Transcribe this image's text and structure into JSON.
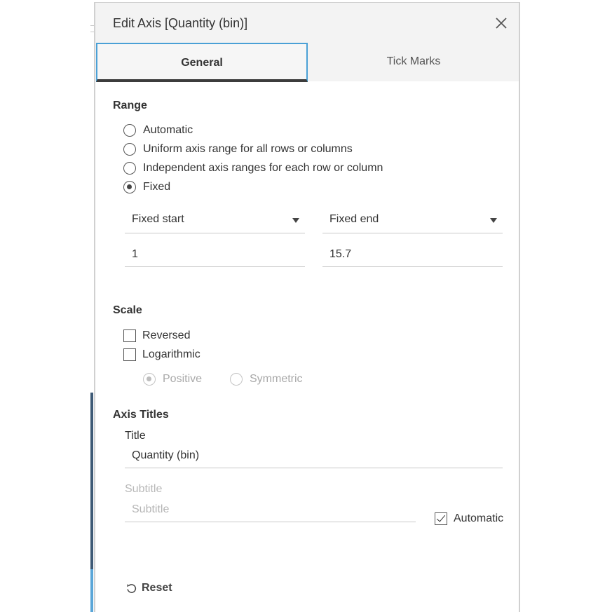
{
  "dialog": {
    "title": "Edit Axis [Quantity (bin)]"
  },
  "tabs": [
    {
      "label": "General",
      "active": true
    },
    {
      "label": "Tick Marks",
      "active": false
    }
  ],
  "range": {
    "heading": "Range",
    "options": [
      {
        "label": "Automatic",
        "checked": false
      },
      {
        "label": "Uniform axis range for all rows or columns",
        "checked": false
      },
      {
        "label": "Independent axis ranges for each row or column",
        "checked": false
      },
      {
        "label": "Fixed",
        "checked": true
      }
    ],
    "start_select": "Fixed start",
    "end_select": "Fixed end",
    "start_value": "1",
    "end_value": "15.7"
  },
  "scale": {
    "heading": "Scale",
    "reversed": {
      "label": "Reversed",
      "checked": false
    },
    "logarithmic": {
      "label": "Logarithmic",
      "checked": false
    },
    "log_options": [
      {
        "label": "Positive",
        "checked": true,
        "disabled": true
      },
      {
        "label": "Symmetric",
        "checked": false,
        "disabled": true
      }
    ]
  },
  "axis_titles": {
    "heading": "Axis Titles",
    "title_label": "Title",
    "title_value": "Quantity (bin)",
    "subtitle_label": "Subtitle",
    "subtitle_placeholder": "Subtitle",
    "automatic": {
      "label": "Automatic",
      "checked": true
    }
  },
  "footer": {
    "reset_label": "Reset"
  },
  "colors": {
    "tab_active_border": "#4aa0d6",
    "header_bg": "#f3f3f3",
    "sidebar_accent_dark": "#3e5a76",
    "sidebar_accent_light": "#5aa6d8"
  },
  "icons": {
    "close": "close-icon",
    "reset": "reset-icon"
  }
}
